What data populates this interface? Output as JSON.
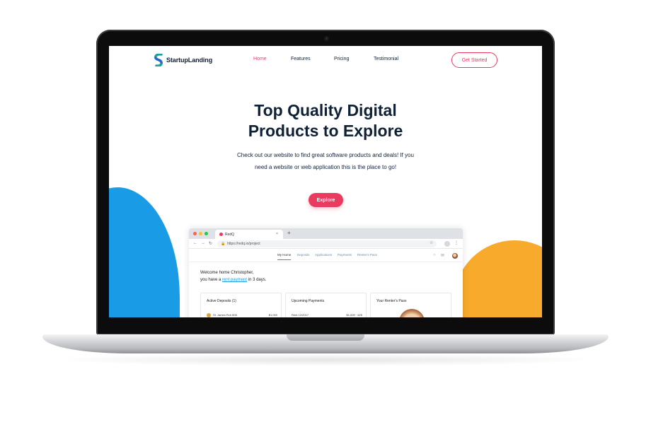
{
  "brand": {
    "name": "StartupLanding",
    "colors": {
      "teal": "#17a3a0",
      "blue": "#2b64c7"
    }
  },
  "nav": {
    "links": [
      {
        "label": "Home",
        "active": true
      },
      {
        "label": "Features",
        "active": false
      },
      {
        "label": "Pricing",
        "active": false
      },
      {
        "label": "Testimonial",
        "active": false
      }
    ],
    "cta": "Get Started"
  },
  "hero": {
    "title_line1": "Top Quality Digital",
    "title_line2": "Products to Explore",
    "description": "Check out our website to find great software products and deals! If you need a website or web application this is the place to go!",
    "button": "Explore"
  },
  "colors": {
    "accent": "#ea3a60",
    "blob_blue": "#1a9be6",
    "blob_yellow": "#f7aa2b",
    "text": "#0f2137"
  },
  "browser": {
    "tab_title": "RedQ",
    "tab_close": "×",
    "new_tab": "+",
    "url": "https://redq.io/project",
    "icons": {
      "back": "←",
      "forward": "→",
      "reload": "↻",
      "star": "☆",
      "menu": "⋮"
    },
    "app_tabs": [
      {
        "label": "My Home",
        "active": true
      },
      {
        "label": "Deposits",
        "active": false
      },
      {
        "label": "Applications",
        "active": false
      },
      {
        "label": "Payments",
        "active": false
      },
      {
        "label": "Renter's Pass",
        "active": false
      }
    ],
    "welcome_line1": "Welcome home Christopher,",
    "welcome_pre": "you have a ",
    "welcome_link": "rent payment",
    "welcome_post": " in 3 days.",
    "cards": [
      {
        "title": "Active Deposits (1)",
        "row_label": "St. James Rch 806",
        "row_value": "$1,000"
      },
      {
        "title": "Upcoming Payments",
        "row_label": "Rent 12/2017",
        "row_value": "$1,699 · 625"
      },
      {
        "title": "Your Renter's Pass"
      }
    ]
  }
}
